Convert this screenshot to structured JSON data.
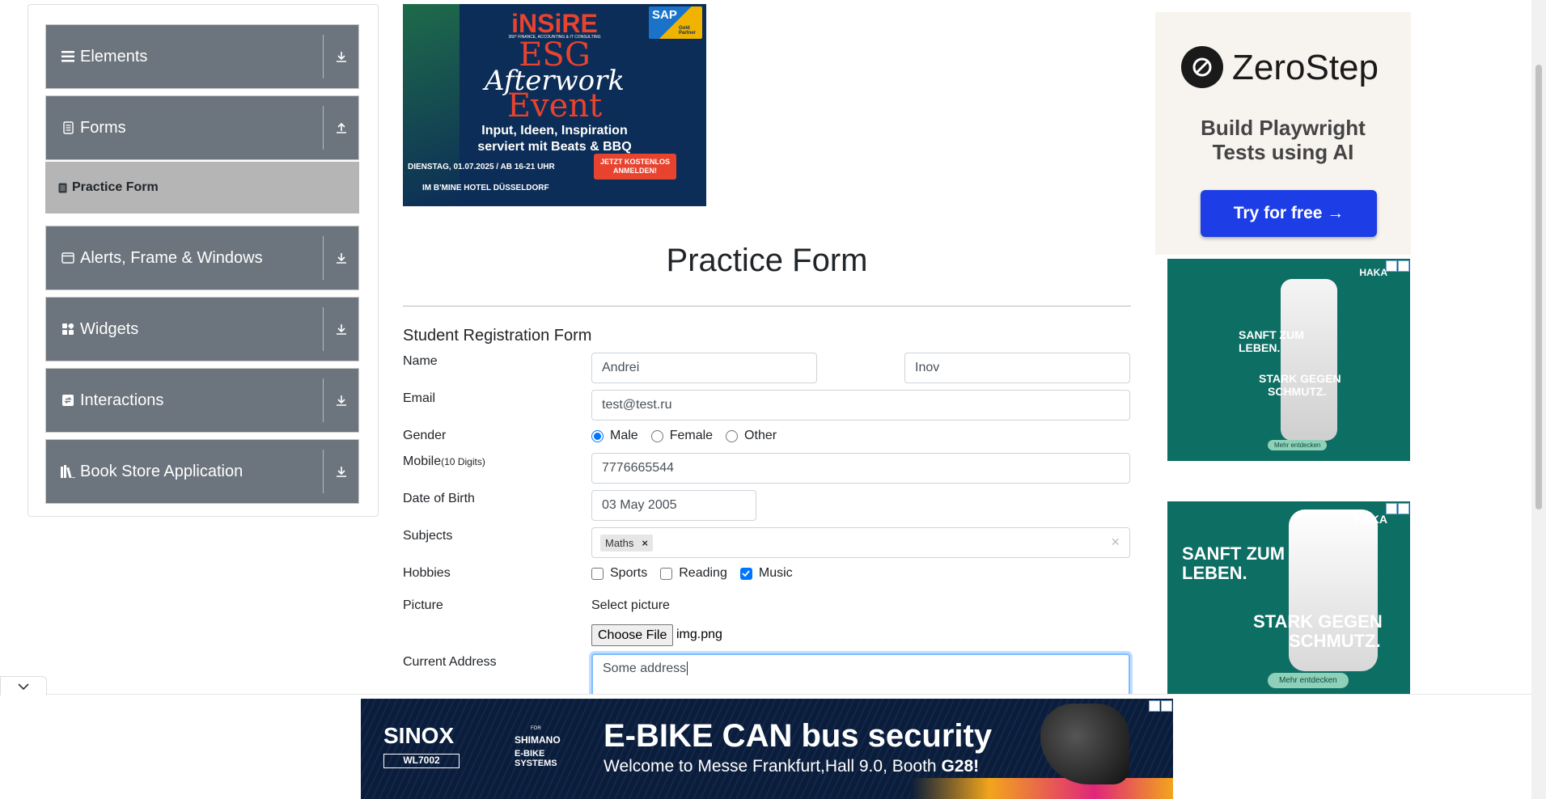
{
  "sidebar": {
    "groups": [
      {
        "label": "Elements",
        "icon": "menu-icon",
        "arrow": "download-icon"
      },
      {
        "label": "Forms",
        "icon": "document-icon",
        "arrow": "upload-icon"
      },
      {
        "label": "Alerts, Frame & Windows",
        "icon": "window-icon",
        "arrow": "download-icon"
      },
      {
        "label": "Widgets",
        "icon": "widgets-icon",
        "arrow": "download-icon"
      },
      {
        "label": "Interactions",
        "icon": "interactions-icon",
        "arrow": "download-icon"
      },
      {
        "label": "Book Store Application",
        "icon": "books-icon",
        "arrow": "download-icon"
      }
    ],
    "active_item": "Practice Form"
  },
  "main": {
    "title": "Practice Form",
    "form_heading": "Student Registration Form",
    "labels": {
      "name": "Name",
      "email": "Email",
      "gender": "Gender",
      "mobile": "Mobile",
      "mobile_hint": "(10 Digits)",
      "dob": "Date of Birth",
      "subjects": "Subjects",
      "hobbies": "Hobbies",
      "picture": "Picture",
      "address": "Current Address"
    },
    "values": {
      "first_name": "Andrei",
      "last_name": "Inov",
      "email": "test@test.ru",
      "mobile": "7776665544",
      "dob": "03 May 2005",
      "subject_chip": "Maths",
      "address": "Some address"
    },
    "gender_options": [
      {
        "label": "Male",
        "checked": true
      },
      {
        "label": "Female",
        "checked": false
      },
      {
        "label": "Other",
        "checked": false
      }
    ],
    "hobby_options": [
      {
        "label": "Sports",
        "checked": false
      },
      {
        "label": "Reading",
        "checked": false
      },
      {
        "label": "Music",
        "checked": true
      }
    ],
    "picture": {
      "select_label": "Select picture",
      "button_label": "Choose File",
      "file_name": "img.png"
    }
  },
  "ads": {
    "top": {
      "brand": "iNSiRE",
      "tagline": "360° FINANCE, ACCOUNTING & IT CONSULTING",
      "line1": "ESG",
      "line2": "Afterwork",
      "line3": "Event",
      "desc1": "Input, Ideen, Inspiration",
      "desc2": "serviert mit Beats & BBQ",
      "date": "DIENSTAG, 01.07.2025 / AB 16-21 UHR",
      "venue": "IM B'MINE HOTEL DÜSSELDORF",
      "cta": "JETZT KOSTENLOS ANMELDEN!",
      "partner": "SAP",
      "partner_badge": "Gold Partner"
    },
    "zerostep": {
      "brand": "ZeroStep",
      "headline1": "Build Playwright",
      "headline2": "Tests using AI",
      "cta": "Try for free →"
    },
    "haka1": {
      "brand": "HAKA",
      "line1": "SANFT ZUM",
      "line2": "LEBEN.",
      "line3": "STARK GEGEN",
      "line4": "SCHMUTZ.",
      "cta": "Mehr entdecken"
    },
    "haka2": {
      "brand": "HAKA",
      "line1": "SANFT ZUM",
      "line2": "LEBEN.",
      "line3": "STARK GEGEN",
      "line4": "SCHMUTZ.",
      "cta": "Mehr entdecken"
    },
    "bottom": {
      "brand": "SINOX",
      "model": "WL7002",
      "for": "FOR",
      "partner": "SHIMANO",
      "partner_sub": "E-BIKE SYSTEMS",
      "headline": "E-BIKE CAN bus security",
      "subline_prefix": "Welcome to Messe Frankfurt,Hall 9.0, Booth ",
      "booth": "G28!"
    }
  },
  "colors": {
    "sidebar_group": "#6c757d",
    "sidebar_active": "#b5b5b5",
    "checked_blue": "#0075ff",
    "zerostep_cta": "#1d3ee6",
    "haka_green": "#0d6e63"
  }
}
